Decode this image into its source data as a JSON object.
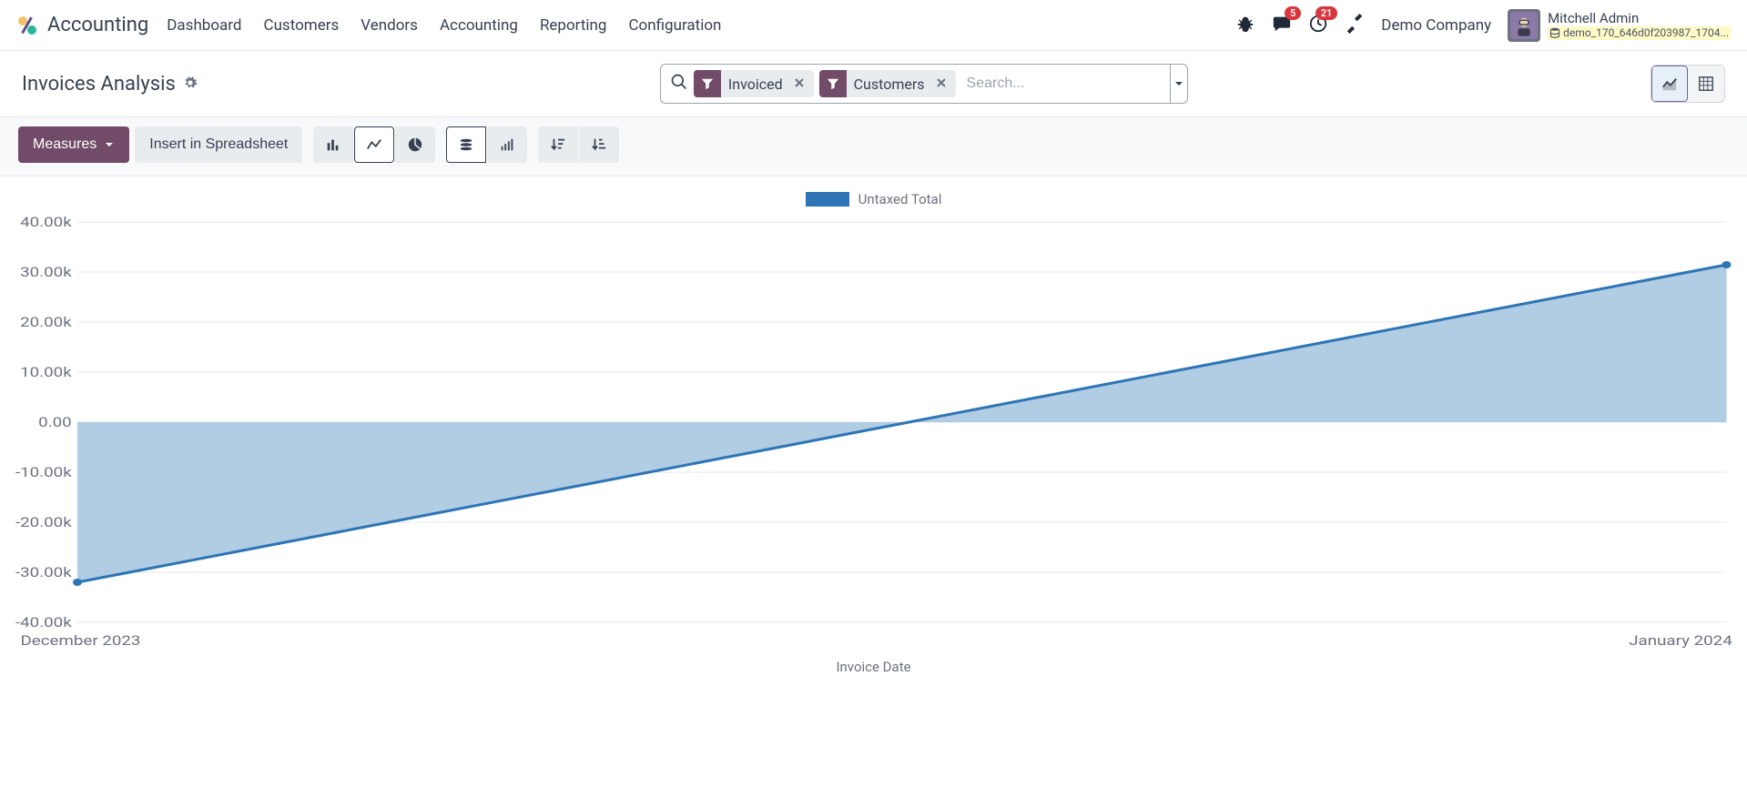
{
  "brand": {
    "title": "Accounting"
  },
  "nav": {
    "items": [
      "Dashboard",
      "Customers",
      "Vendors",
      "Accounting",
      "Reporting",
      "Configuration"
    ]
  },
  "messaging_badge": "5",
  "activity_badge": "21",
  "company": "Demo Company",
  "user": {
    "name": "Mitchell Admin",
    "db": "demo_170_646d0f203987_1704..."
  },
  "page_title": "Invoices Analysis",
  "search": {
    "placeholder": "Search...",
    "tags": [
      {
        "label": "Invoiced"
      },
      {
        "label": "Customers"
      }
    ]
  },
  "toolbar": {
    "measures": "Measures",
    "spreadsheet": "Insert in Spreadsheet"
  },
  "legend": "Untaxed Total",
  "xaxis_label": "Invoice Date",
  "chart_data": {
    "type": "line",
    "title": "",
    "xlabel": "Invoice Date",
    "ylabel": "",
    "ylim": [
      -40000,
      40000
    ],
    "yticks": [
      "40.00k",
      "30.00k",
      "20.00k",
      "10.00k",
      "0.00",
      "-10.00k",
      "-20.00k",
      "-30.00k",
      "-40.00k"
    ],
    "categories": [
      "December 2023",
      "January 2024"
    ],
    "series": [
      {
        "name": "Untaxed Total",
        "values": [
          -32000,
          31500
        ]
      }
    ]
  }
}
